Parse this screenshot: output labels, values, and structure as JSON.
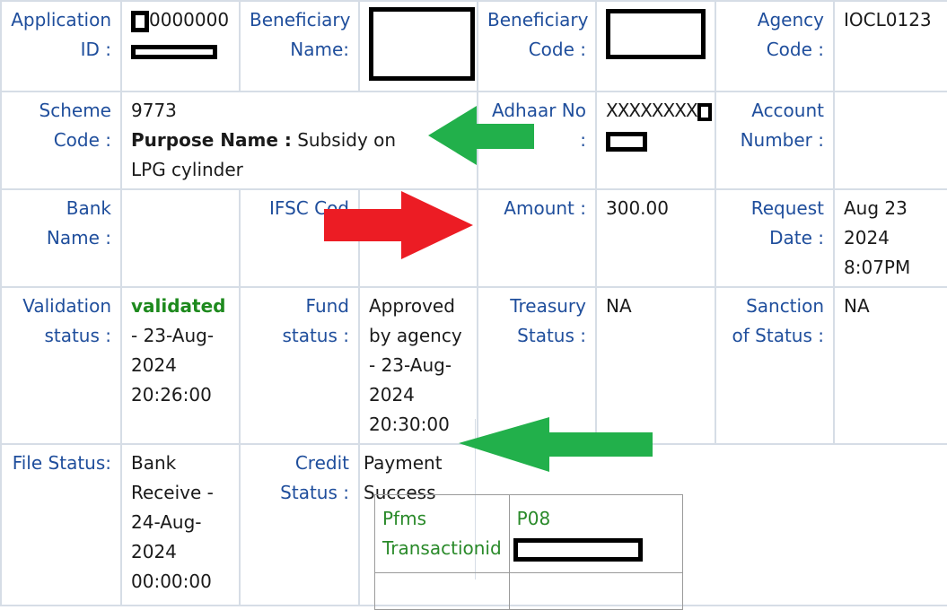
{
  "rows": [
    {
      "cells": [
        {
          "label": "Application ID :",
          "value": "0000000"
        },
        {
          "label": "Beneficiary Name:",
          "value": ""
        },
        {
          "label": "Beneficiary Code :",
          "value": ""
        },
        {
          "label": "Agency Code :",
          "value": "IOCL0123"
        }
      ]
    },
    {
      "cells": [
        {
          "label": "Scheme Code :",
          "value": "9773"
        },
        {
          "label": "Adhaar No :",
          "value": "XXXXXXXX"
        },
        {
          "label": "Account Number :",
          "value": ""
        }
      ],
      "purpose_label": "Purpose Name :",
      "purpose_value": "Subsidy on LPG cylinder"
    },
    {
      "cells": [
        {
          "label": "Bank Name :",
          "value": ""
        },
        {
          "label": "IFSC Cod",
          "value": ""
        },
        {
          "label": "Amount :",
          "value": "300.00"
        },
        {
          "label": "Request Date :",
          "value": "Aug 23 2024 8:07PM"
        }
      ]
    },
    {
      "cells": [
        {
          "label": "Validation status :",
          "value_status": "validated",
          "value": " - 23-Aug-2024 20:26:00"
        },
        {
          "label": "Fund status :",
          "value": "Approved by agency - 23-Aug-2024 20:30:00"
        },
        {
          "label": "Treasury Status :",
          "value": "NA"
        },
        {
          "label": "Sanction of Status :",
          "value": "NA"
        }
      ]
    },
    {
      "cells": [
        {
          "label": "File Status:",
          "value": "Bank Receive - 24-Aug-2024 00:00:00"
        },
        {
          "label": "Credit Status :",
          "value": "Payment Success"
        }
      ]
    }
  ],
  "pfms": {
    "label": "Pfms Transactionid",
    "value": "P08"
  },
  "annotations": {
    "green_color": "#22b04b",
    "red_color": "#ec1c24"
  }
}
